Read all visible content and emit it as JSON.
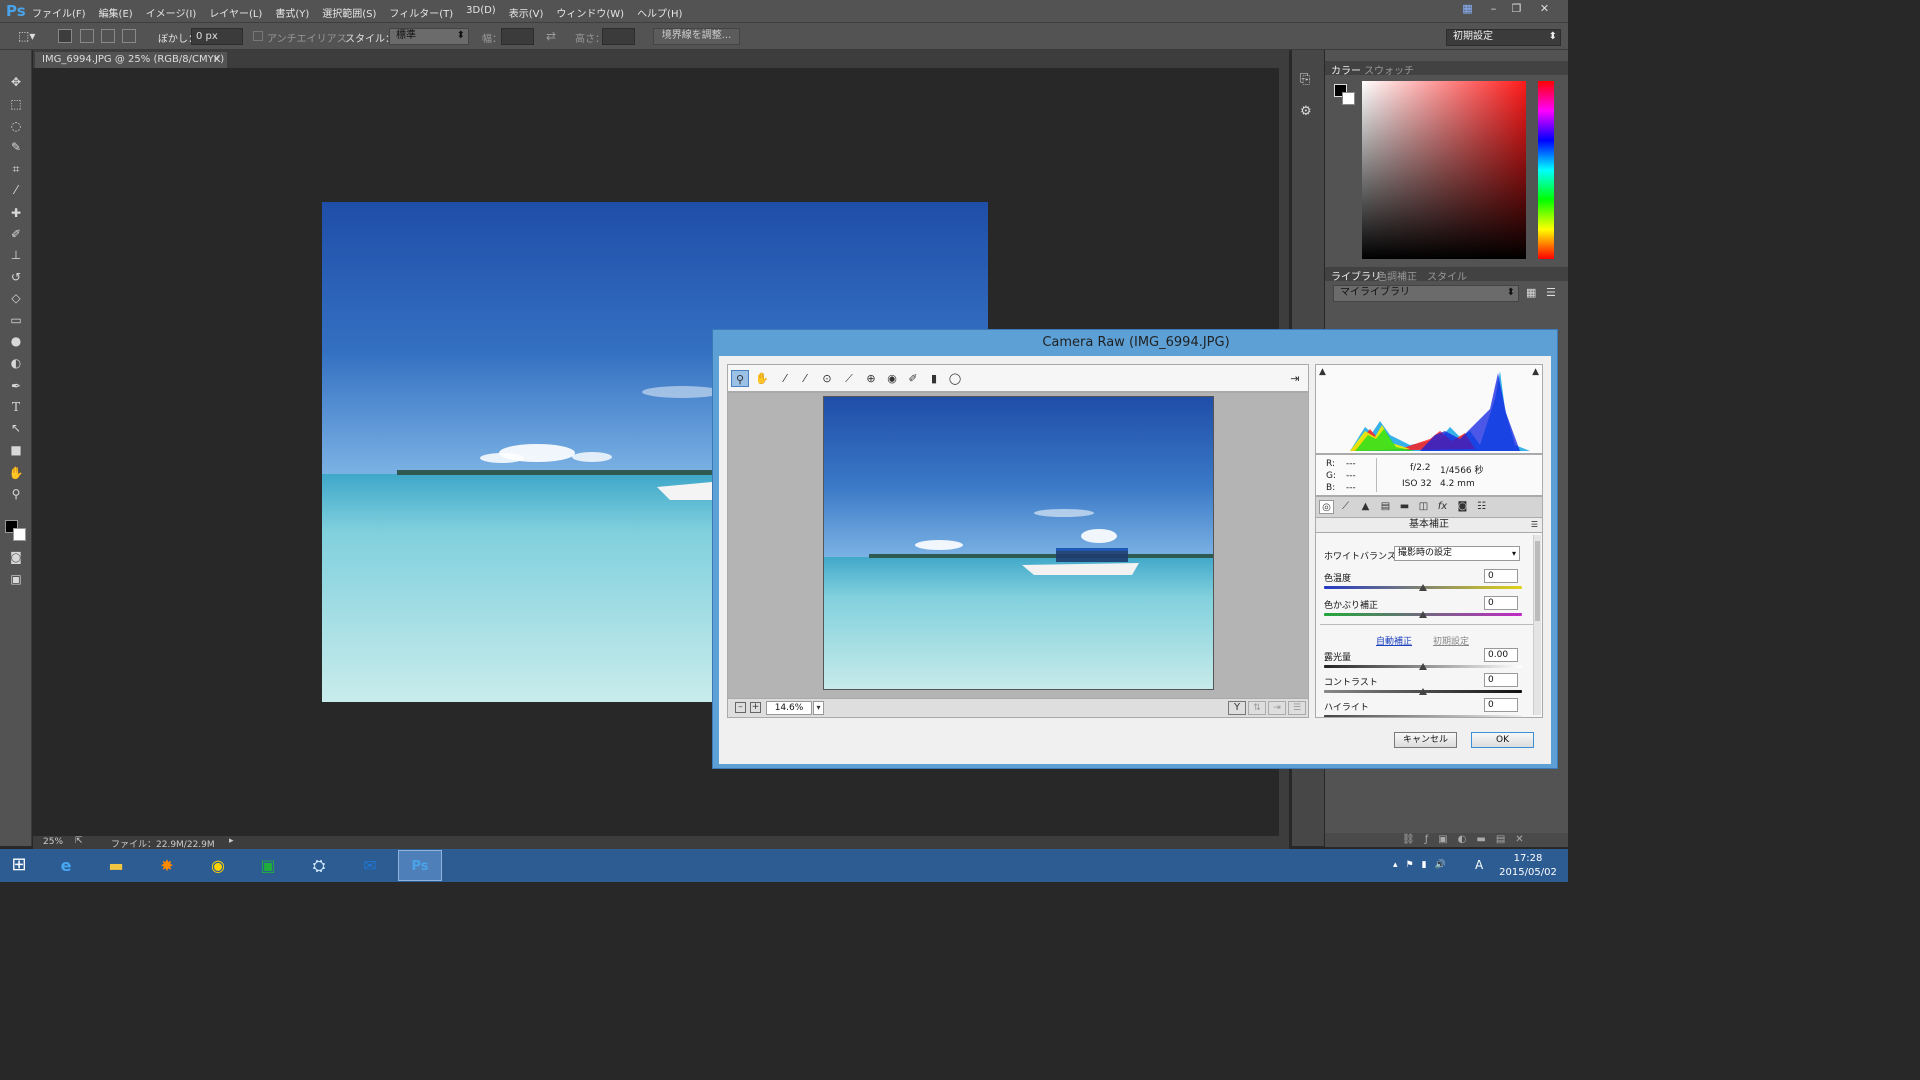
{
  "app": {
    "logo": "Ps"
  },
  "menu": [
    "ファイル(F)",
    "編集(E)",
    "イメージ(I)",
    "レイヤー(L)",
    "書式(Y)",
    "選択範囲(S)",
    "フィルター(T)",
    "3D(D)",
    "表示(V)",
    "ウィンドウ(W)",
    "ヘルプ(H)"
  ],
  "options": {
    "feather_label": "ぼかし：",
    "feather_value": "0 px",
    "antialias_label": "アンチエイリアス",
    "style_label": "スタイル：",
    "style_value": "標準",
    "width_label": "幅：",
    "height_label": "高さ：",
    "refine_button": "境界線を調整...",
    "workspace": "初期設定"
  },
  "document": {
    "tab": "IMG_6994.JPG @ 25% (RGB/8/CMYK)",
    "close": "×"
  },
  "status": {
    "zoom": "25%",
    "file": "ファイル：22.9M/22.9M"
  },
  "right_panel": {
    "tabs_top": [
      "カラー",
      "スウォッチ"
    ],
    "tabs_lib": [
      "ライブラリ",
      "色調補正",
      "スタイル"
    ],
    "library_select": "マイライブラリ"
  },
  "camera_raw": {
    "title": "Camera Raw (IMG_6994.JPG)",
    "zoom": "14.6%",
    "info": {
      "r_label": "R:",
      "g_label": "G:",
      "b_label": "B:",
      "r": "---",
      "g": "---",
      "b": "---",
      "aperture": "f/2.2",
      "shutter": "1/4566 秒",
      "iso": "ISO 32",
      "focal": "4.2 mm"
    },
    "panel_title": "基本補正",
    "wb_label": "ホワイトバランス：",
    "wb_value": "撮影時の設定",
    "temp_label": "色温度",
    "temp_value": "0",
    "tint_label": "色かぶり補正",
    "tint_value": "0",
    "auto_link": "自動補正",
    "default_link": "初期設定",
    "exposure_label": "露光量",
    "exposure_value": "0.00",
    "contrast_label": "コントラスト",
    "contrast_value": "0",
    "highlights_label": "ハイライト",
    "highlights_value": "0",
    "cancel": "キャンセル",
    "ok": "OK"
  },
  "taskbar": {
    "time": "17:28",
    "date": "2015/05/02",
    "ime": "A"
  },
  "colors": {
    "accent": "#5ca0d6",
    "taskbar": "#2d5c93",
    "ps_bg": "#535353",
    "canvas": "#282828"
  }
}
